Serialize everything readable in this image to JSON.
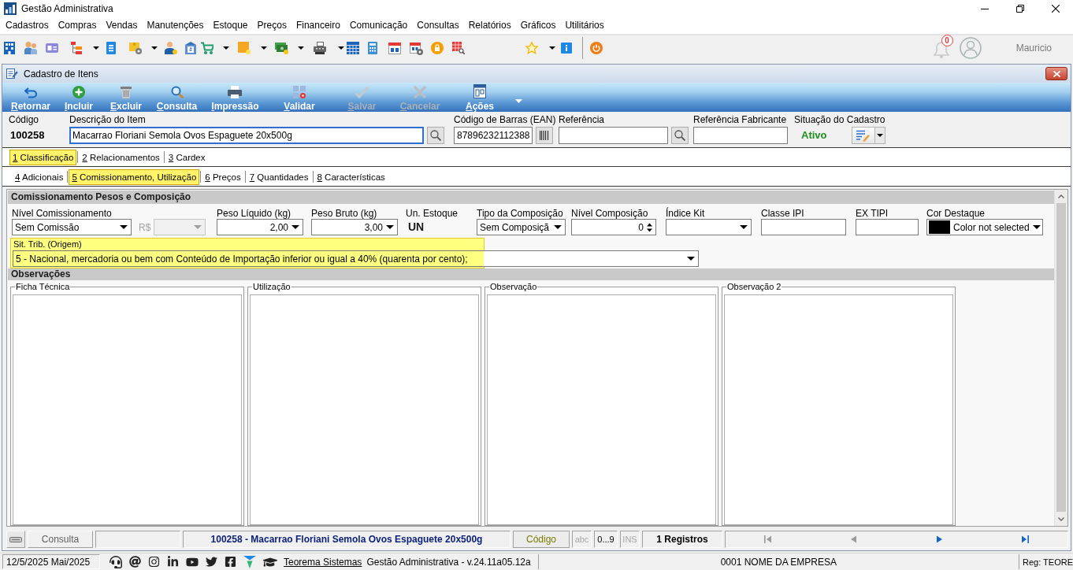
{
  "window": {
    "title": "Gestão Administrativa"
  },
  "menu": [
    "Cadastros",
    "Compras",
    "Vendas",
    "Manutenções",
    "Estoque",
    "Preços",
    "Financeiro",
    "Comunicação",
    "Consultas",
    "Relatórios",
    "Gráficos",
    "Utilitários"
  ],
  "notifications": {
    "count": "0"
  },
  "user": {
    "name": "Mauricio"
  },
  "form_window": {
    "title": "Cadastro de Itens",
    "actions": [
      {
        "kind": "return",
        "label": "Retornar",
        "disabled": false
      },
      {
        "kind": "add",
        "label": "Incluir",
        "disabled": false
      },
      {
        "kind": "delete",
        "label": "Excluir",
        "disabled": false
      },
      {
        "kind": "search",
        "label": "Consulta",
        "disabled": false
      },
      {
        "kind": "print",
        "label": "Impressão",
        "disabled": false
      },
      {
        "kind": "validate",
        "label": "Validar",
        "disabled": false
      },
      {
        "kind": "save",
        "label": "Salvar",
        "disabled": true
      },
      {
        "kind": "cancel",
        "label": "Cancelar",
        "disabled": true
      },
      {
        "kind": "actions",
        "label": "Ações",
        "disabled": false
      }
    ],
    "header_fields": [
      {
        "kind": "code",
        "label": "Código",
        "value": "100258"
      },
      {
        "kind": "search",
        "label": "Descrição do Item",
        "value": "Macarrao Floriani Semola Ovos Espaguete 20x500g",
        "focused": true
      },
      {
        "kind": "barcode",
        "label": "Código de Barras (EAN)",
        "value": "87896232112388",
        "focused": false
      },
      {
        "kind": "search",
        "label": "Referência",
        "focused": false
      },
      {
        "kind": "text",
        "label": "Referência Fabricante",
        "focused": false
      },
      {
        "kind": "status",
        "label": "Situação do Cadastro",
        "value": "Ativo"
      }
    ],
    "tab_rows": [
      [
        {
          "label": "1 Classificação",
          "selected": true
        },
        {
          "label": "2 Relacionamentos",
          "selected": false
        },
        {
          "label": "3 Cardex",
          "selected": false
        }
      ],
      [
        {
          "label": "4 Adicionais",
          "selected": false
        },
        {
          "label": "5 Comissionamento, Utilização",
          "selected": true
        },
        {
          "label": "6 Preços",
          "selected": false
        },
        {
          "label": "7 Quantidades",
          "selected": false
        },
        {
          "label": "8 Características",
          "selected": false
        }
      ]
    ],
    "commission_section": {
      "title": "Comissionamento Pesos e Composição",
      "fields": [
        {
          "kind": "select",
          "label": "Nível Comissionamento",
          "value": "Sem Comissão",
          "disabled": false
        },
        {
          "kind": "inline-select",
          "label": "R$",
          "disabled": true
        },
        {
          "kind": "number-select",
          "label": "Peso Líquido (kg)",
          "value": "2,00",
          "disabled": false
        },
        {
          "kind": "number-select",
          "label": "Peso Bruto (kg)",
          "value": "3,00",
          "disabled": false
        },
        {
          "kind": "unit",
          "label": "Un. Estoque",
          "value": "UN",
          "disabled": false
        },
        {
          "kind": "select",
          "label": "Tipo da Composição",
          "value": "Sem Composiçã",
          "disabled": false
        },
        {
          "kind": "spin",
          "label": "Nível Composição",
          "value": "0",
          "disabled": false
        },
        {
          "kind": "select",
          "label": "Índice Kit",
          "disabled": false
        },
        {
          "kind": "text",
          "label": "Classe IPI",
          "disabled": false
        },
        {
          "kind": "text",
          "label": "EX TIPI",
          "disabled": false
        },
        {
          "kind": "color",
          "label": "Cor Destaque",
          "value": "Color not selected",
          "color": "#000000",
          "disabled": false
        }
      ],
      "origin": {
        "label": "Sit. Trib. (Origem)",
        "value": "5 - Nacional, mercadoria ou bem com Conteúdo de Importação inferior ou igual a 40% (quarenta por cento);",
        "highlighted": true
      }
    },
    "notes_section": {
      "title": "Observações",
      "notes": [
        {
          "label": "Ficha Técnica"
        },
        {
          "label": "Utilização"
        },
        {
          "label": "Observação"
        },
        {
          "label": "Observação 2"
        }
      ]
    }
  },
  "record_bar": {
    "mode": "Consulta",
    "record": "100258 - Macarrao Floriani Semola Ovos Espaguete 20x500g",
    "sort_key": "Código",
    "indicators": [
      {
        "label": "abc",
        "on": false
      },
      {
        "label": "0...9",
        "on": true
      },
      {
        "label": "INS",
        "on": false
      }
    ],
    "count": "1 Registros",
    "navigation": [
      {
        "kind": "first",
        "disabled": true
      },
      {
        "kind": "previous",
        "disabled": true
      },
      {
        "kind": "next",
        "disabled": false
      },
      {
        "kind": "last",
        "disabled": false
      }
    ]
  },
  "status_bar": {
    "date": "12/5/2025 Mai/2025",
    "link": "Teorema Sistemas",
    "version": "Gestão Administrativa - v.24.11a05.12a",
    "company": "0001 NOME DA EMPRESA",
    "registration": "Reg: TEORE"
  }
}
